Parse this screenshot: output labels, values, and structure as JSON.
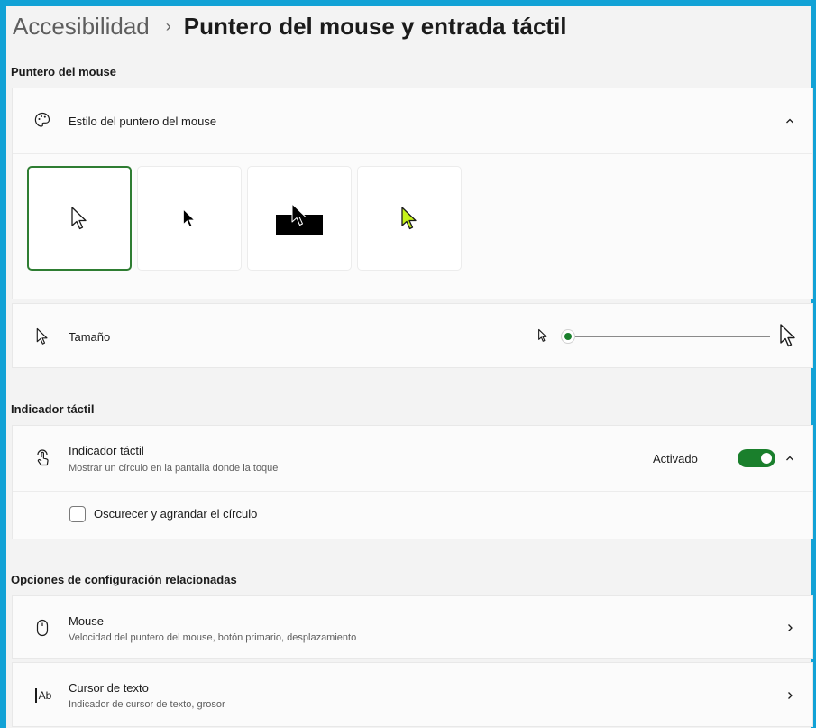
{
  "breadcrumb": {
    "parent": "Accesibilidad",
    "separator": "›",
    "current": "Puntero del mouse y entrada táctil"
  },
  "sections": {
    "mouse_pointer": "Puntero del mouse",
    "touch_indicator": "Indicador táctil",
    "related": "Opciones de configuración relacionadas"
  },
  "pointer_style": {
    "title": "Estilo del puntero del mouse",
    "icon": "palette-icon",
    "expanded": true,
    "options": [
      {
        "name": "white",
        "selected": true
      },
      {
        "name": "black",
        "selected": false
      },
      {
        "name": "inverted",
        "selected": false
      },
      {
        "name": "custom",
        "selected": false,
        "color": "#c6f21a"
      }
    ]
  },
  "pointer_size": {
    "title": "Tamaño",
    "icon": "pointer-icon",
    "value": 1,
    "min": 1,
    "max": 15
  },
  "touch_indicator": {
    "title": "Indicador táctil",
    "subtitle": "Mostrar un círculo en la pantalla donde la toque",
    "icon": "touch-icon",
    "state_label": "Activado",
    "enabled": true,
    "expanded": true,
    "checkbox_label": "Oscurecer y agrandar el círculo",
    "checkbox_checked": false
  },
  "related": [
    {
      "title": "Mouse",
      "subtitle": "Velocidad del puntero del mouse, botón primario, desplazamiento",
      "icon": "mouse-icon"
    },
    {
      "title": "Cursor de texto",
      "subtitle": "Indicador de cursor de texto, grosor",
      "icon": "text-cursor-icon",
      "icon_text": "Ab"
    }
  ],
  "colors": {
    "accent": "#1a7f2c",
    "selected_border": "#2e7d32",
    "frame": "#12a2d6",
    "custom_pointer": "#c6f21a"
  }
}
